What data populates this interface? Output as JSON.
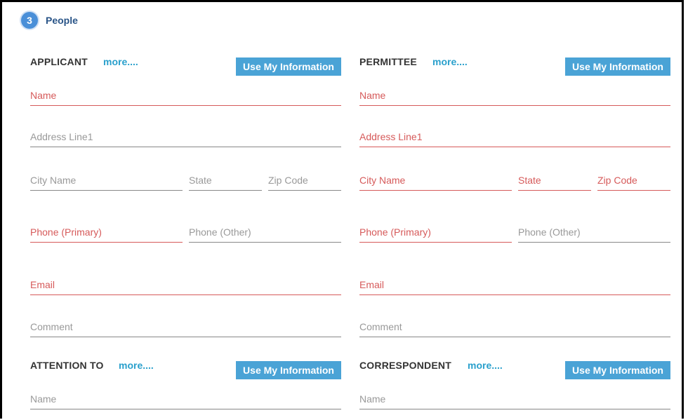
{
  "section": {
    "number": "3",
    "title": "People"
  },
  "blocks": {
    "applicant": {
      "title": "APPLICANT",
      "more": "more....",
      "button": "Use My Information",
      "fields": {
        "name": "Name",
        "address": "Address Line1",
        "city": "City Name",
        "state": "State",
        "zip": "Zip Code",
        "phone_primary": "Phone (Primary)",
        "phone_other": "Phone (Other)",
        "email": "Email",
        "comment": "Comment"
      }
    },
    "permittee": {
      "title": "PERMITTEE",
      "more": "more....",
      "button": "Use My Information",
      "fields": {
        "name": "Name",
        "address": "Address Line1",
        "city": "City Name",
        "state": "State",
        "zip": "Zip Code",
        "phone_primary": "Phone (Primary)",
        "phone_other": "Phone (Other)",
        "email": "Email",
        "comment": "Comment"
      }
    },
    "attention": {
      "title": "ATTENTION TO",
      "more": "more....",
      "button": "Use My Information",
      "fields": {
        "name": "Name"
      }
    },
    "correspondent": {
      "title": "CORRESPONDENT",
      "more": "more....",
      "button": "Use My Information",
      "fields": {
        "name": "Name"
      }
    }
  },
  "colors": {
    "required": "#d65a5a",
    "link": "#2aa0cc",
    "button": "#4aa3d6",
    "badge": "#4a8fd8",
    "section_title": "#2a5588"
  }
}
